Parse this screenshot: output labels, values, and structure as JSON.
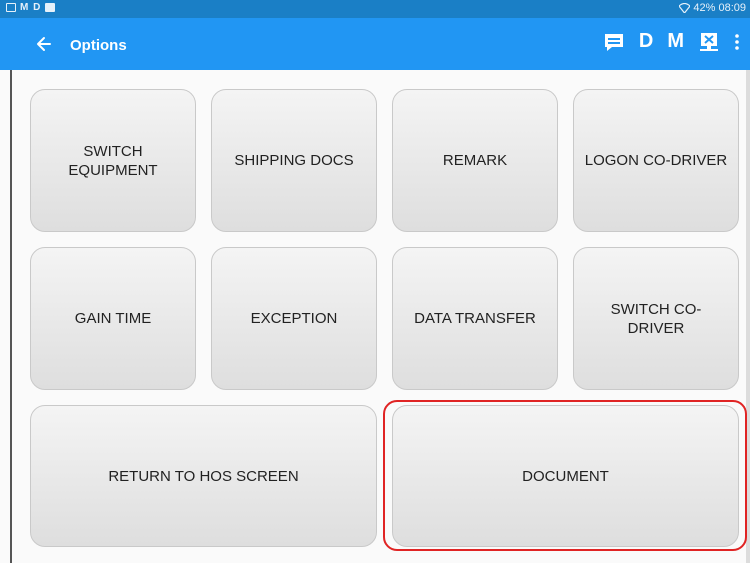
{
  "status_bar": {
    "left_letters": "M D",
    "right_text": "42% 08:09"
  },
  "app_bar": {
    "title": "Options",
    "action_d": "D",
    "action_m": "M"
  },
  "options": {
    "switch_equipment": "SWITCH EQUIPMENT",
    "shipping_docs": "SHIPPING DOCS",
    "remark": "REMARK",
    "logon_co_driver": "LOGON CO-DRIVER",
    "gain_time": "GAIN TIME",
    "exception": "EXCEPTION",
    "data_transfer": "DATA TRANSFER",
    "switch_co_driver": "SWITCH CO-DRIVER",
    "return_to_hos": "RETURN TO HOS SCREEN",
    "document": "DOCUMENT"
  },
  "colors": {
    "app_bar": "#2196f3",
    "status_bar": "#1a7fc6",
    "highlight": "#e02424"
  },
  "icons": [
    "back-arrow-icon",
    "message-icon",
    "monitor-icon",
    "overflow-menu-icon",
    "wifi-icon",
    "battery-icon"
  ]
}
